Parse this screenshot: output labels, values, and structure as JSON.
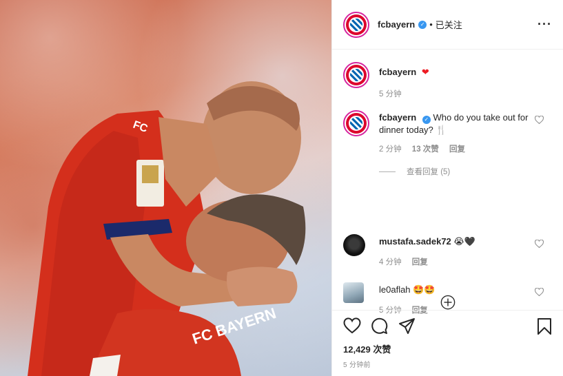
{
  "header": {
    "username": "fcbayern",
    "separator": "•",
    "follow_status": "已关注",
    "more_icon": "more-dots-icon"
  },
  "caption": {
    "username": "fcbayern",
    "emoji": "❤",
    "time": "5 分钟"
  },
  "comments": [
    {
      "username": "fcbayern",
      "text": "Who do you take out for dinner today? 🍴",
      "time": "2 分钟",
      "likes": "13 次赞",
      "reply": "回复",
      "view_replies": "查看回复 (5)"
    },
    {
      "username": "mustafa.sadek72",
      "text": "😭🖤",
      "time": "4 分钟",
      "reply": "回复"
    },
    {
      "username": "le0aflah",
      "text": "🤩🤩",
      "time": "5 分钟",
      "reply": "回复"
    }
  ],
  "actions": {
    "like_icon": "heart-icon",
    "comment_icon": "comment-icon",
    "share_icon": "share-icon",
    "save_icon": "bookmark-icon",
    "like_count": "12,429 次赞",
    "posted_time": "5 分钟前"
  },
  "colors": {
    "verified": "#3897f0",
    "bayern_red": "#dc052d",
    "heart_red": "#ed4956",
    "muted": "#8e8e8e"
  }
}
